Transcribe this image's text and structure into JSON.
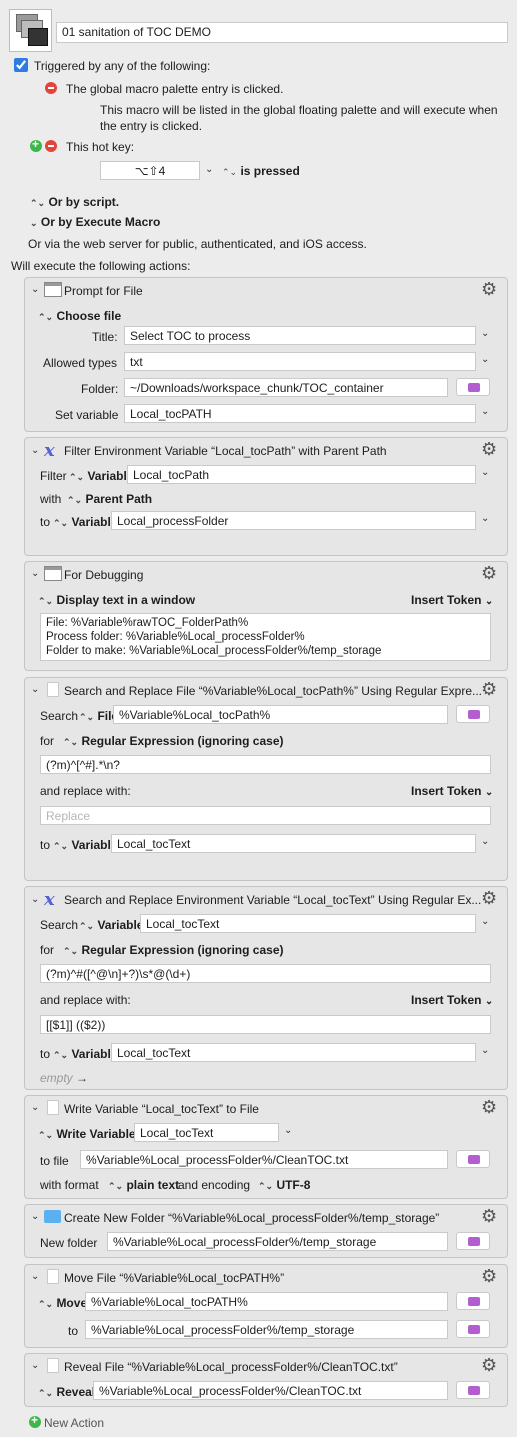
{
  "macro": {
    "name": "01 sanitation of TOC  DEMO",
    "triggered_label": "Triggered by any of the following:",
    "palette_trigger": "The global macro palette entry is clicked.",
    "palette_desc_line1": "This macro will be listed in the global floating palette and will execute when",
    "palette_desc_line2": "the entry is clicked.",
    "hotkey_label": "This hot key:",
    "hotkey_value": "⌥⇧4",
    "hotkey_state": "is pressed",
    "or_script": "Or by script.",
    "or_execute": "Or by Execute Macro",
    "or_web": "Or via the web server for public, authenticated, and iOS access.",
    "will_execute": "Will execute the following actions:",
    "new_action": "New Action"
  },
  "actions": {
    "a1": {
      "title": "Prompt for File",
      "mode": "Choose file",
      "title_label": "Title:",
      "title_value": "Select TOC to process",
      "types_label": "Allowed types",
      "types_value": "txt",
      "folder_label": "Folder:",
      "folder_value": "~/Downloads/workspace_chunk/TOC_container",
      "setvar_label": "Set variable",
      "setvar_value": "Local_tocPATH"
    },
    "a2": {
      "title": "Filter Environment Variable “Local_tocPath” with Parent Path",
      "filter_label": "Filter",
      "kind": "Variable",
      "filter_value": "Local_tocPath",
      "with_label": "with",
      "with_value": "Parent Path",
      "to_label": "to",
      "to_kind": "Variable",
      "to_value": "Local_processFolder"
    },
    "a3": {
      "title": "For Debugging",
      "mode": "Display text in a window",
      "insert_token": "Insert Token",
      "line1": "File: %Variable%rawTOC_FolderPath%",
      "line2": "Process folder: %Variable%Local_processFolder%",
      "line3": "Folder to make: %Variable%Local_processFolder%/temp_storage"
    },
    "a4": {
      "title": "Search and Replace File “%Variable%Local_tocPath%” Using Regular Expre...",
      "search_label": "Search",
      "search_kind": "File",
      "search_value": "%Variable%Local_tocPath%",
      "for_label": "for",
      "for_value": "Regular Expression (ignoring case)",
      "regex": "(?m)^[^#].*\\n?",
      "replace_label": "and replace with:",
      "insert_token": "Insert Token",
      "replace_placeholder": "Replace",
      "to_label": "to",
      "to_kind": "Variable",
      "to_value": "Local_tocText"
    },
    "a5": {
      "title": "Search and Replace Environment Variable “Local_tocText” Using Regular Ex...",
      "search_label": "Search",
      "search_kind": "Variable",
      "search_value": "Local_tocText",
      "for_label": "for",
      "for_value": "Regular Expression (ignoring case)",
      "regex": "(?m)^#([^@\\n]+?)\\s*@(\\d+)",
      "replace_label": "and replace with:",
      "insert_token": "Insert Token",
      "replace_value": "[[$1]] (($2))",
      "to_label": "to",
      "to_kind": "Variable",
      "to_value": "Local_tocText",
      "empty": "empty"
    },
    "a6": {
      "title": "Write Variable “Local_tocText” to File",
      "write_label": "Write Variable",
      "write_value": "Local_tocText",
      "tofile_label": "to file",
      "tofile_value": "%Variable%Local_processFolder%/CleanTOC.txt",
      "format_label": "with format",
      "format_value": "plain text",
      "encoding_label": "and encoding",
      "encoding_value": "UTF-8"
    },
    "a7": {
      "title": "Create New Folder “%Variable%Local_processFolder%/temp_storage”",
      "label": "New folder",
      "value": "%Variable%Local_processFolder%/temp_storage"
    },
    "a8": {
      "title": "Move File “%Variable%Local_tocPATH%”",
      "move_label": "Move",
      "move_value": "%Variable%Local_tocPATH%",
      "to_label": "to",
      "to_value": "%Variable%Local_processFolder%/temp_storage"
    },
    "a9": {
      "title": "Reveal File “%Variable%Local_processFolder%/CleanTOC.txt”",
      "label": "Reveal",
      "value": "%Variable%Local_processFolder%/CleanTOC.txt"
    }
  }
}
